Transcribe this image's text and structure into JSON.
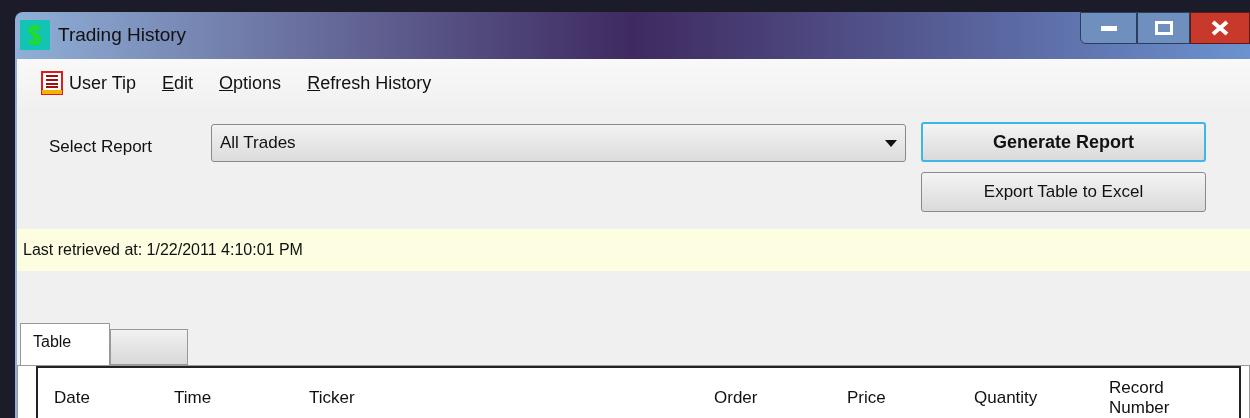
{
  "window": {
    "title": "Trading History"
  },
  "menu": [
    {
      "label": "User Tip",
      "kind": "icon",
      "access_key_underlined": false
    },
    {
      "label": "Edit",
      "kind": "plain",
      "access_key_underlined": true
    },
    {
      "label": "Options",
      "kind": "plain",
      "access_key_underlined": true
    },
    {
      "label": "Refresh History",
      "kind": "plain",
      "access_key_underlined": true
    }
  ],
  "report": {
    "label": "Select Report",
    "value": "All Trades"
  },
  "buttons": [
    {
      "label": "Generate Report",
      "focused": true
    },
    {
      "label": "Export Table to Excel",
      "focused": false
    }
  ],
  "info_bar": "Last retrieved at: 1/22/2011 4:10:01 PM",
  "tabs": [
    {
      "label": "Table",
      "selected": true
    },
    {
      "selected": false
    }
  ],
  "table": {
    "columns": [
      {
        "label": "Date"
      },
      {
        "label": "Time"
      },
      {
        "label": "Ticker"
      },
      {
        "label": "Order"
      },
      {
        "label": "Price"
      },
      {
        "label": "Quantity"
      },
      {
        "label": "Record Number"
      }
    ]
  }
}
